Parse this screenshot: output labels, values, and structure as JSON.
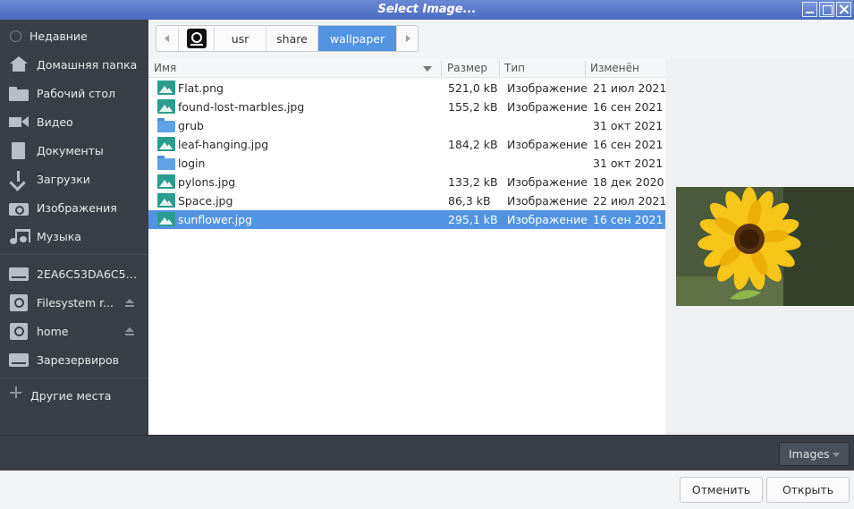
{
  "window": {
    "title": "Select Image..."
  },
  "sidebar": {
    "places": [
      {
        "label": "Недавние",
        "icon": "clock-icon"
      },
      {
        "label": "Домашняя папка",
        "icon": "home-icon"
      },
      {
        "label": "Рабочий стол",
        "icon": "folder-icon"
      },
      {
        "label": "Видео",
        "icon": "video-icon"
      },
      {
        "label": "Документы",
        "icon": "document-icon"
      },
      {
        "label": "Загрузки",
        "icon": "download-icon"
      },
      {
        "label": "Изображения",
        "icon": "camera-icon"
      },
      {
        "label": "Музыка",
        "icon": "music-icon"
      }
    ],
    "devices": [
      {
        "label": "2EA6C53DA6C50...",
        "icon": "drive-icon"
      },
      {
        "label": "Filesystem r...",
        "icon": "disk-icon"
      },
      {
        "label": "home",
        "icon": "disk-icon"
      },
      {
        "label": "Зарезервиров",
        "icon": "drive-icon"
      }
    ],
    "other": {
      "label": "Другие места",
      "icon": "plus-icon"
    }
  },
  "pathbar": {
    "segments": [
      "usr",
      "share",
      "wallpaper"
    ],
    "active": "wallpaper"
  },
  "columns": {
    "name": "Имя",
    "size": "Размер",
    "type": "Тип",
    "modified": "Изменён"
  },
  "files": [
    {
      "name": "Flat.png",
      "size": "521,0 kB",
      "type": "Изображение",
      "modified": "21 июл 2021",
      "kind": "image"
    },
    {
      "name": "found-lost-marbles.jpg",
      "size": "155,2 kB",
      "type": "Изображение",
      "modified": "16 сен 2021",
      "kind": "image"
    },
    {
      "name": "grub",
      "size": "",
      "type": "",
      "modified": "31 окт 2021",
      "kind": "folder"
    },
    {
      "name": "leaf-hanging.jpg",
      "size": "184,2 kB",
      "type": "Изображение",
      "modified": "16 сен 2021",
      "kind": "image"
    },
    {
      "name": "login",
      "size": "",
      "type": "",
      "modified": "31 окт 2021",
      "kind": "folder"
    },
    {
      "name": "pylons.jpg",
      "size": "133,2 kB",
      "type": "Изображение",
      "modified": "18 дек 2020",
      "kind": "image"
    },
    {
      "name": "Space.jpg",
      "size": "86,3 kB",
      "type": "Изображение",
      "modified": "22 июл 2021",
      "kind": "image"
    },
    {
      "name": "sunflower.jpg",
      "size": "295,1 kB",
      "type": "Изображение",
      "modified": "16 сен 2021",
      "kind": "image",
      "selected": true
    }
  ],
  "filter": {
    "label": "Images"
  },
  "actions": {
    "cancel": "Отменить",
    "open": "Открыть"
  },
  "colors": {
    "accent": "#5294e2",
    "sidebar": "#3a3f47",
    "titlebar": "#4a6bbf"
  }
}
